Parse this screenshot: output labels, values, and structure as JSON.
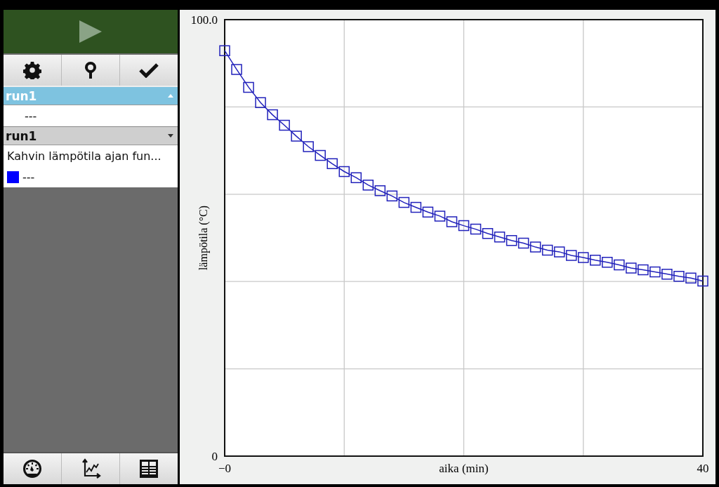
{
  "datasets": [
    {
      "name": "run1",
      "selected": true,
      "rows": [
        {
          "kind": "value",
          "text": "---"
        }
      ]
    },
    {
      "name": "run1",
      "selected": false,
      "rows": [
        {
          "kind": "title",
          "text": "Kahvin lämpötila ajan fun..."
        },
        {
          "kind": "series",
          "color": "#0000ff",
          "text": "---"
        }
      ]
    }
  ],
  "graph": {
    "chart_data": {
      "type": "line",
      "xlabel": "aika (min)",
      "ylabel": "lämpötila (°C)",
      "x": [
        0,
        1,
        2,
        3,
        4,
        5,
        6,
        7,
        8,
        9,
        10,
        11,
        12,
        13,
        14,
        15,
        16,
        17,
        18,
        19,
        20,
        21,
        22,
        23,
        24,
        25,
        26,
        27,
        28,
        29,
        30,
        31,
        32,
        33,
        34,
        35,
        36,
        37,
        38,
        39,
        40
      ],
      "xlim": [
        0,
        40
      ],
      "ylim": [
        0,
        100
      ],
      "xticks": [
        {
          "value": 0,
          "label": "−0"
        },
        {
          "value": 40,
          "label": "40"
        }
      ],
      "yticks": [
        0,
        {
          "value": 100,
          "label": "100.0"
        }
      ],
      "series": [
        {
          "color": "#2222bb",
          "marker": "square",
          "values": [
            92.9,
            88.6,
            84.5,
            81.0,
            78.2,
            75.8,
            73.3,
            70.9,
            68.9,
            67.0,
            65.2,
            63.8,
            62.1,
            60.8,
            59.6,
            58.1,
            57.0,
            55.9,
            55.0,
            53.7,
            52.8,
            52.0,
            51.0,
            50.2,
            49.4,
            48.8,
            47.9,
            47.2,
            46.8,
            46.0,
            45.5,
            44.9,
            44.4,
            43.8,
            43.1,
            42.7,
            42.2,
            41.7,
            41.2,
            40.8,
            40.1
          ]
        }
      ]
    }
  }
}
